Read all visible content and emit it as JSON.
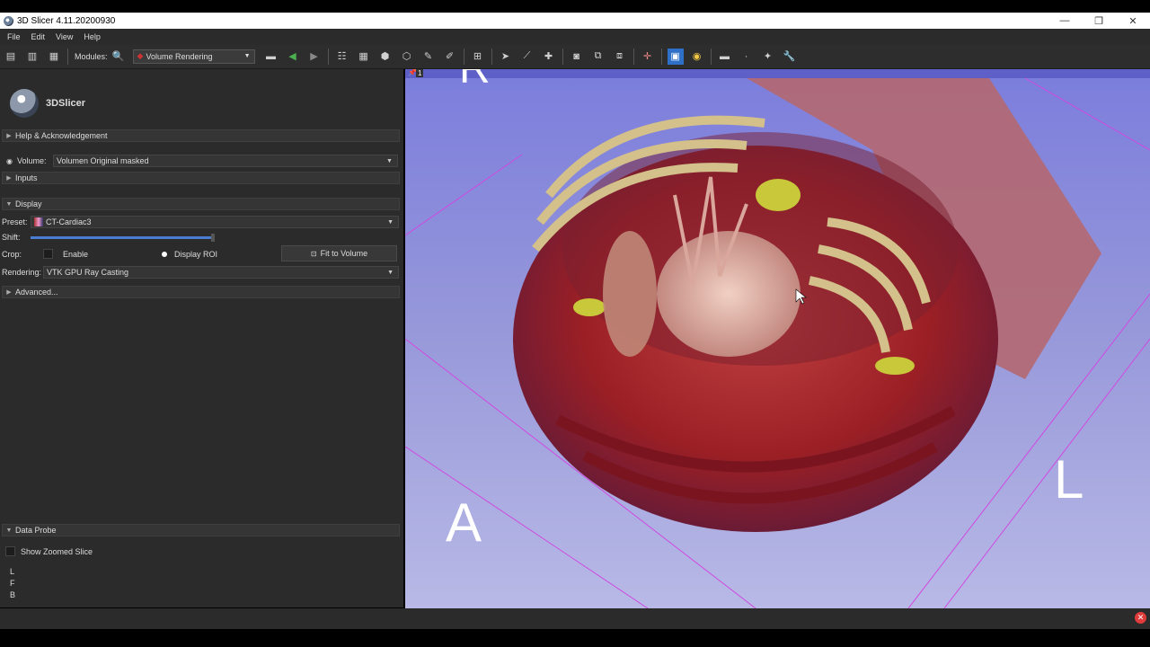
{
  "window": {
    "title": "3D Slicer 4.11.20200930"
  },
  "menu": {
    "items": [
      "File",
      "Edit",
      "View",
      "Help"
    ]
  },
  "toolbar": {
    "modules_label": "Modules:",
    "module_selected": "Volume Rendering"
  },
  "panel": {
    "logo_text": "3DSlicer",
    "help_section": "Help & Acknowledgement",
    "volume_label": "Volume:",
    "volume_value": "Volumen Original masked",
    "inputs_section": "Inputs",
    "display_section": "Display",
    "preset_label": "Preset:",
    "preset_value": "CT-Cardiac3",
    "shift_label": "Shift:",
    "shift_level": 0.7,
    "crop_label": "Crop:",
    "enable_label": "Enable",
    "display_roi_label": "Display ROI",
    "fit_button": "Fit to Volume",
    "rendering_label": "Rendering:",
    "rendering_value": "VTK GPU Ray Casting",
    "advanced_section": "Advanced...",
    "data_probe_section": "Data Probe",
    "show_zoomed_label": "Show Zoomed Slice",
    "probe_lines": [
      "L",
      "F",
      "B"
    ]
  },
  "viewport": {
    "view_number": "1",
    "orientation": {
      "top": "R",
      "left": "A",
      "right": "L"
    }
  },
  "colors": {
    "accent": "#4a7dd1",
    "viewport_bg": "#8c8edc",
    "error": "#e03b3b"
  }
}
